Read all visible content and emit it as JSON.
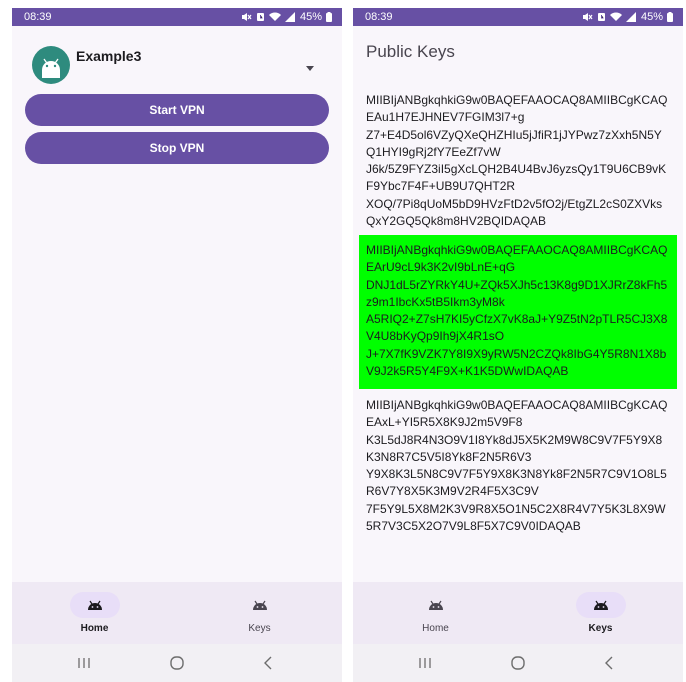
{
  "status_bar": {
    "time": "08:39",
    "battery": "45%"
  },
  "home": {
    "app_name": "Example3",
    "start_vpn_label": "Start VPN",
    "stop_vpn_label": "Stop VPN"
  },
  "keys": {
    "title": "Public Keys",
    "items": [
      {
        "text": "MIIBIjANBgkqhkiG9w0BAQEFAAOCAQ8AMIIBCgKCAQEAu1H7EJHNEV7FGIM3l7+g\nZ7+E4D5ol6VZyQXeQHZHIu5jJfiR1jJYPwz7zXxh5N5YQ1HYI9gRj2fY7EeZf7vW\nJ6k/5Z9FYZ3iI5gXcLQH2B4U4BvJ6yzsQy1T9U6CB9vKF9Ybc7F4F+UB9U7QHT2R\nXOQ/7Pi8qUoM5bD9HVzFtD2v5fO2j/EtgZL2cS0ZXVksQxY2GQ5Qk8m8HV2BQIDAQAB",
        "highlighted": false
      },
      {
        "text": "MIIBIjANBgkqhkiG9w0BAQEFAAOCAQ8AMIIBCgKCAQEArU9cL9k3K2vI9bLnE+qG\nDNJ1dL5rZYRkY4U+ZQk5XJh5c13K8g9D1XJRrZ8kFh5z9m1IbcKx5tB5Ikm3yM8k\nA5RIQ2+Z7sH7KI5yCfzX7vK8aJ+Y9Z5tN2pTLR5CJ3X8V4U8bKyQp9Ih9jX4R1sO\nJ+7X7fK9VZK7Y8I9X9yRW5N2CZQk8IbG4Y5R8N1X8bV9J2k5R5Y4F9X+K1K5DWwIDAQAB",
        "highlighted": true
      },
      {
        "text": "MIIBIjANBgkqhkiG9w0BAQEFAAOCAQ8AMIIBCgKCAQEAxL+YI5R5X8K9J2m5V9F8\nK3L5dJ8R4N3O9V1I8Yk8dJ5X5K2M9W8C9V7F5Y9X8K3N8R7C5V5I8Yk8F2N5R6V3\nY9X8K3L5N8C9V7F5Y9X8K3N8Yk8F2N5R7C9V1O8L5R6V7Y8X5K3M9V2R4F5X3C9V\n7F5Y9L5X8M2K3V9R8X5O1N5C2X8R4V7Y5K3L8X9W5R7V3C5X2O7V9L8F5X7C9V0IDAQAB",
        "highlighted": false
      }
    ],
    "highlight_color": "#00ff00"
  },
  "nav": {
    "home_label": "Home",
    "keys_label": "Keys",
    "accent_color": "#6750a4"
  },
  "icons": {
    "status_right": [
      "mute-icon",
      "alarm-icon",
      "wifi-icon",
      "signal-icon",
      "battery-icon"
    ],
    "nav": [
      "android-icon"
    ],
    "system": [
      "recents-icon",
      "home-circle-icon",
      "back-icon"
    ]
  }
}
